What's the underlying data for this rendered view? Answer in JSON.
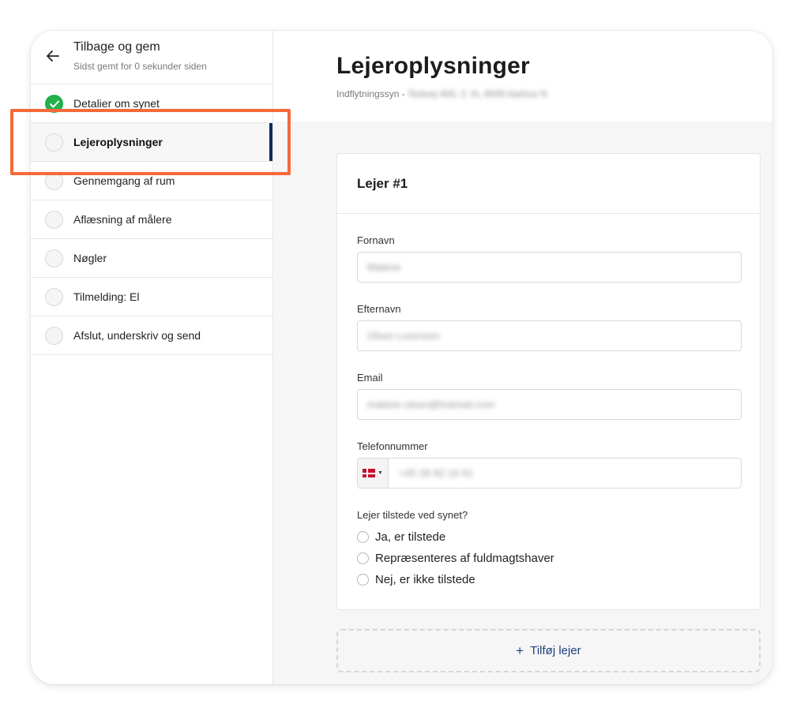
{
  "sidebar": {
    "back_title": "Tilbage og gem",
    "saved_status": "Sidst gemt for 0 sekunder siden",
    "steps": [
      {
        "label": "Detalier om synet",
        "done": true
      },
      {
        "label": "Lejeroplysninger",
        "active": true
      },
      {
        "label": "Gennemgang af rum"
      },
      {
        "label": "Aflæsning af målere"
      },
      {
        "label": "Nøgler"
      },
      {
        "label": "Tilmelding: El"
      },
      {
        "label": "Afslut, underskriv og send"
      }
    ]
  },
  "main": {
    "title": "Lejeroplysninger",
    "subtitle_prefix": "Indflytningssyn -",
    "subtitle_address": "Testvej 400, 2. th, 8000 Aarhus N",
    "card": {
      "title": "Lejer #1",
      "first_name_label": "Fornavn",
      "first_name_value": "Malene",
      "last_name_label": "Efternavn",
      "last_name_value": "Olsen Lorenzen",
      "email_label": "Email",
      "email_value": "malene-olsen@hotmail.com",
      "phone_label": "Telefonnummer",
      "phone_value": "+45 28 82 19 91",
      "presence_question": "Lejer tilstede ved synet?",
      "presence_options": [
        "Ja, er tilstede",
        "Repræsenteres af fuldmagtshaver",
        "Nej, er ikke tilstede"
      ]
    },
    "add_tenant_label": "Tilføj lejer"
  },
  "colors": {
    "accent": "#0f2a5c",
    "success": "#22b14c",
    "highlight": "#f5693a",
    "link": "#1d3f7a"
  }
}
